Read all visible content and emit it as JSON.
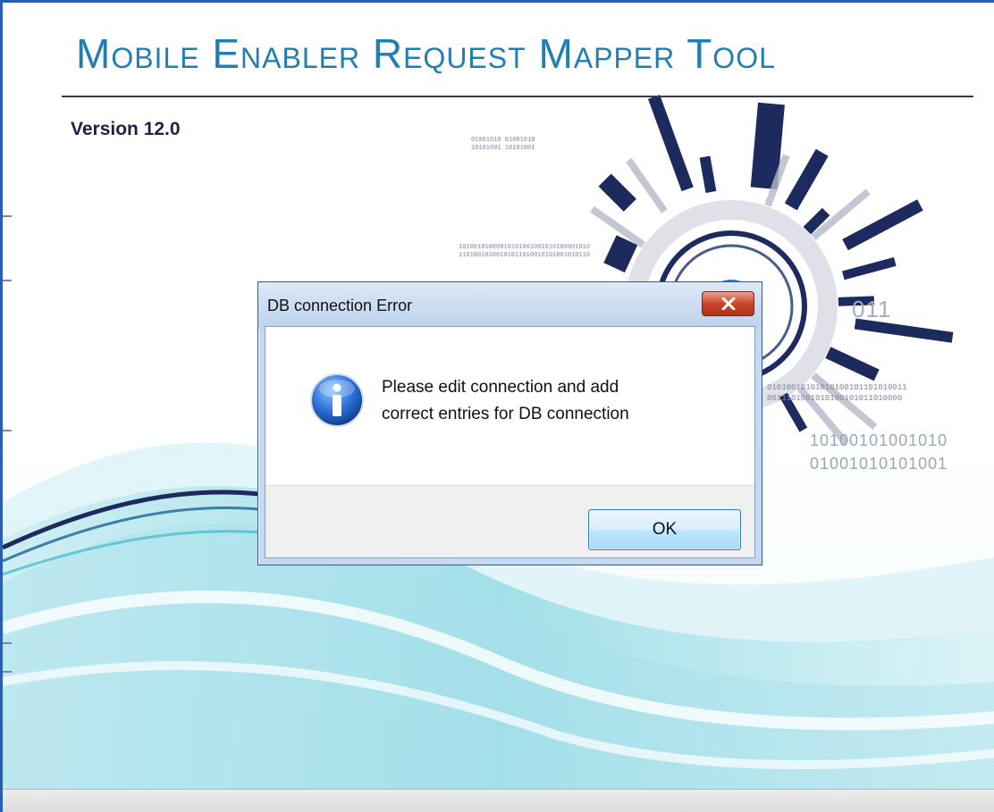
{
  "splash": {
    "title": "Mobile Enabler Request Mapper Tool",
    "version": "Version 12.0",
    "binary_top": [
      "01001010  01001010",
      "10101001  10101001"
    ],
    "binary_mid": [
      "10100101000010101001001010100001010",
      "11010010100101011010010101001010110"
    ],
    "binary_right_small": [
      "01010010101010100101101010011",
      "0011101001010100101011010000"
    ],
    "binary_right_large": [
      "10100101001010",
      "01001010101001"
    ],
    "binary_ring": "011"
  },
  "dialog": {
    "title": "DB connection Error",
    "message_line1": "Please edit connection and add",
    "message_line2": "correct entries for DB connection",
    "ok_label": "OK",
    "icon": "information-icon",
    "close_icon": "close-icon"
  },
  "colors": {
    "title": "#1f7fb2",
    "version": "#1c2344",
    "navy": "#1c2a5e",
    "teal": "#4cbfcf",
    "close_red": "#c9452c"
  }
}
